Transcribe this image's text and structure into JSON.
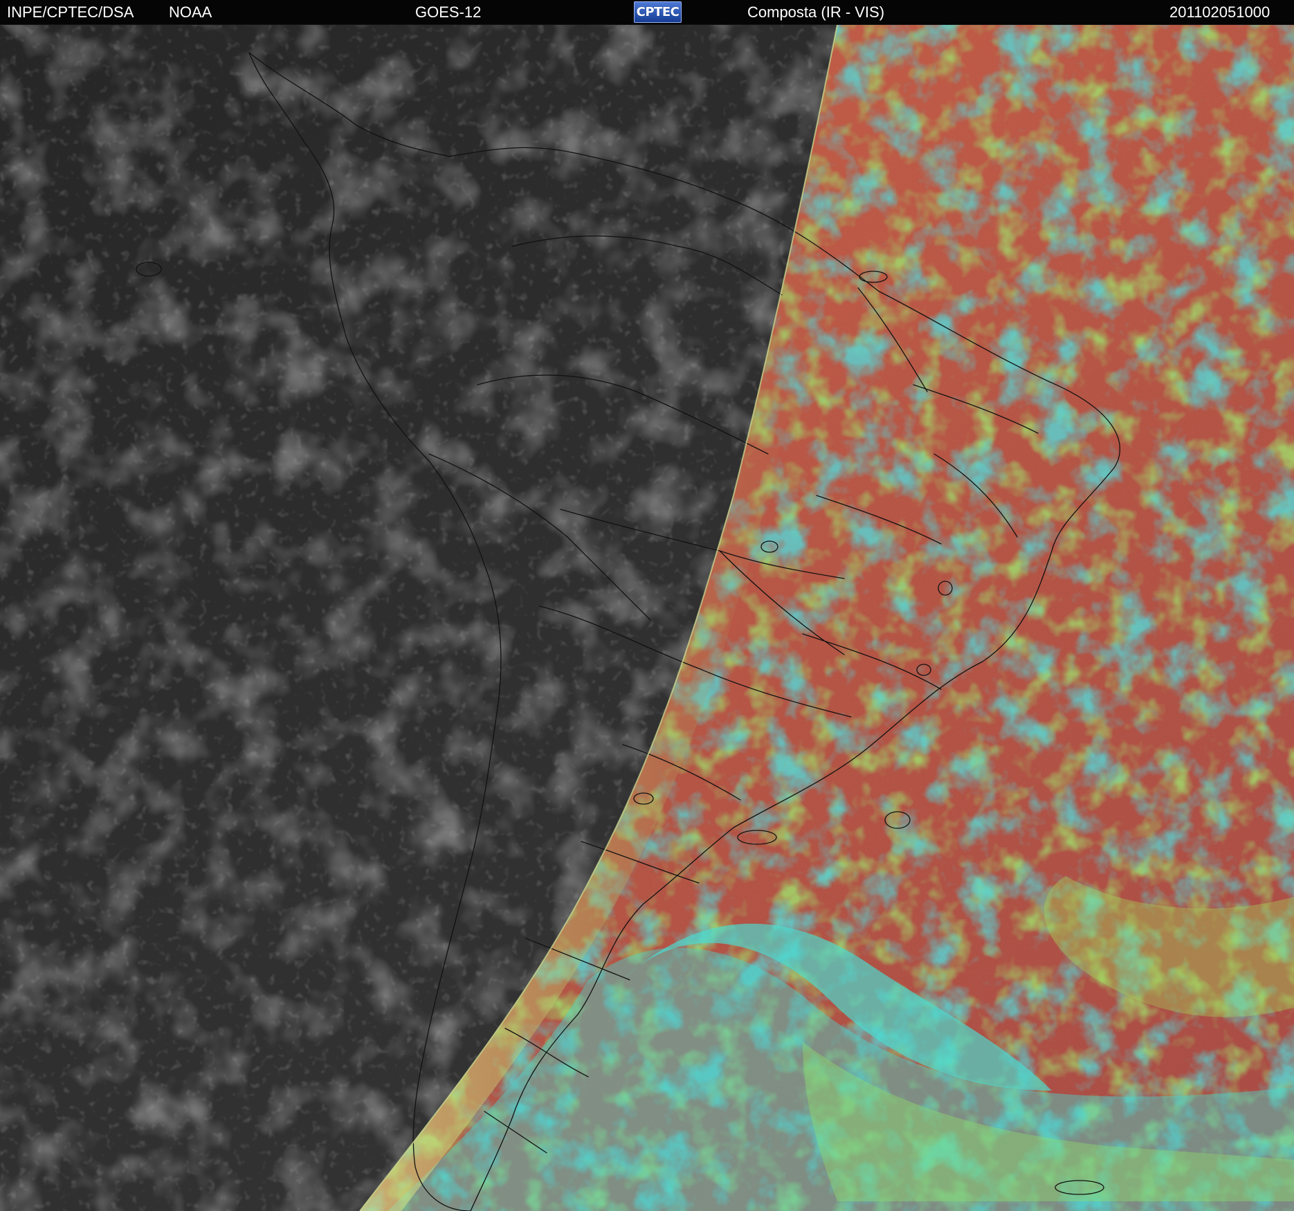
{
  "header": {
    "org": "INPE/CPTEC/DSA",
    "agency": "NOAA",
    "satellite": "GOES-12",
    "logo": "CPTEC",
    "product": "Composta (IR - VIS)",
    "timestamp": "201102051000"
  },
  "colors": {
    "header_bg": "#050505",
    "header_text": "#ffffff",
    "night_ir": "#3a3a3a",
    "day_ocean": "#b65443",
    "day_cloud_cyan": "#42e1dd",
    "day_cloud_green": "#9ce55f",
    "coast_line": "#000000",
    "terminator": "#d2e29a"
  }
}
